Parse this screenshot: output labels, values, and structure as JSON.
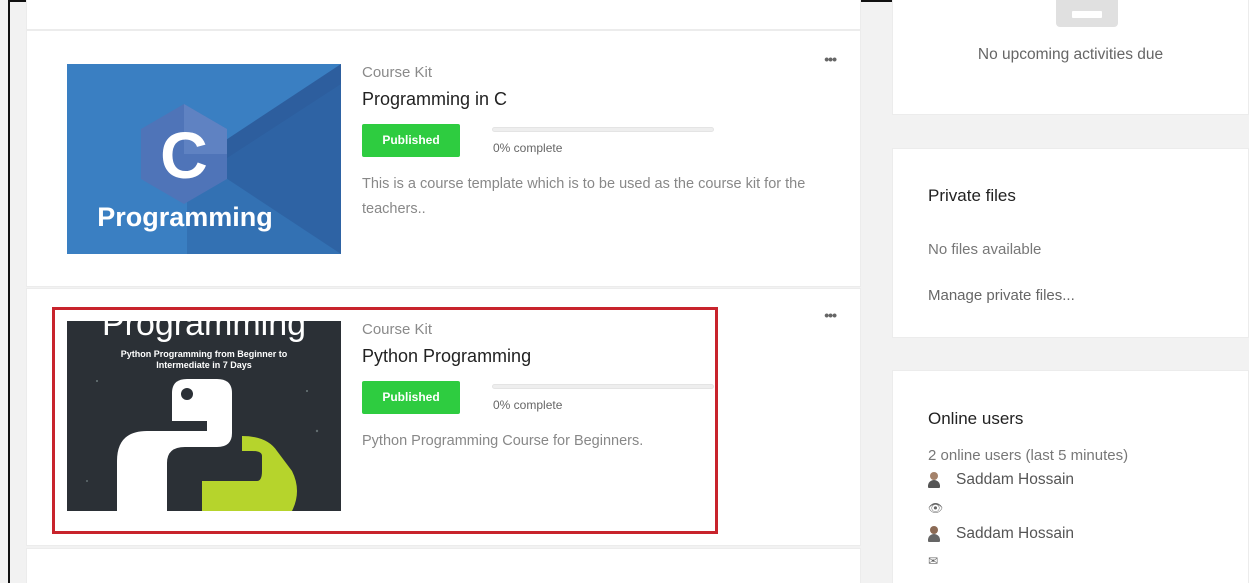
{
  "courses": [
    {
      "category": "Course Kit",
      "title": "Programming in C",
      "status": "Published",
      "progress_percent": 0,
      "progress_text": "0% complete",
      "description": "This is a course template which is to be used as the course kit for the teachers..",
      "thumbnail": {
        "letter": "C",
        "caption": "Programming",
        "colors": {
          "bg": "#3a7fc2",
          "dark": "#2d5e9e",
          "hex": "#4f74b8"
        }
      },
      "menu_label": "•••"
    },
    {
      "category": "Course Kit",
      "title": "Python Programming",
      "status": "Published",
      "progress_percent": 0,
      "progress_text": "0% complete",
      "description": "Python Programming Course for Beginners.",
      "thumbnail": {
        "heading": "Programming",
        "subtitle_line1": "Python Programming from Beginner to",
        "subtitle_line2": "Intermediate in 7 Days",
        "colors": {
          "bg": "#2b3036",
          "snake_top": "#ffffff",
          "snake_bottom": "#b6d42c"
        }
      },
      "menu_label": "•••"
    }
  ],
  "sidebar": {
    "upcoming": {
      "empty_text": "No upcoming activities due",
      "icon": "calendar-icon"
    },
    "private_files": {
      "title": "Private files",
      "empty_text": "No files available",
      "manage_link": "Manage private files..."
    },
    "online_users": {
      "title": "Online users",
      "count_text": "2 online users (last 5 minutes)",
      "users": [
        {
          "name": "Saddam Hossain",
          "action_icon": "eye-icon"
        },
        {
          "name": "Saddam Hossain",
          "action_icon": "message-icon"
        }
      ]
    }
  },
  "colors": {
    "published": "#2ecc40",
    "highlight": "#c8232c"
  }
}
